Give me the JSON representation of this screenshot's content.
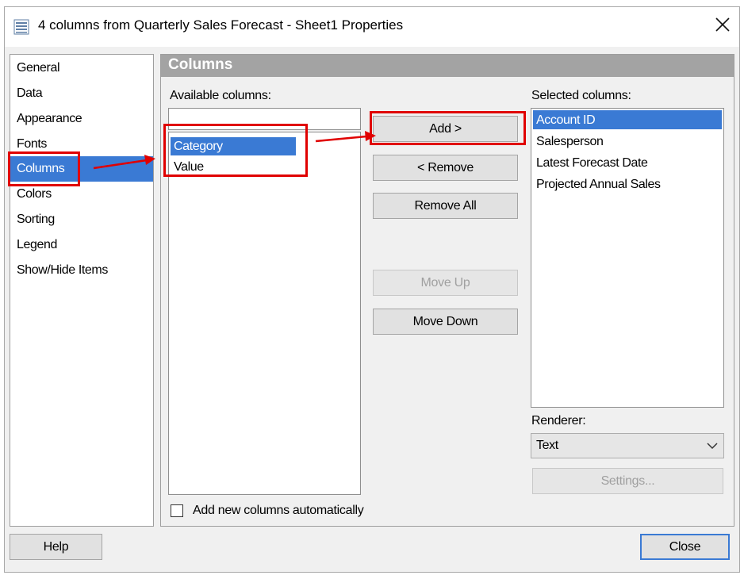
{
  "window": {
    "title": "4 columns from Quarterly Sales Forecast - Sheet1 Properties",
    "icon": "list-icon",
    "close_icon": "close-icon"
  },
  "nav": {
    "items": [
      {
        "label": "General"
      },
      {
        "label": "Data"
      },
      {
        "label": "Appearance"
      },
      {
        "label": "Fonts"
      },
      {
        "label": "Columns",
        "selected": true
      },
      {
        "label": "Colors"
      },
      {
        "label": "Sorting"
      },
      {
        "label": "Legend"
      },
      {
        "label": "Show/Hide Items"
      }
    ]
  },
  "panel": {
    "title": "Columns",
    "available_label": "Available columns:",
    "search_value": "",
    "available": [
      {
        "label": "Category",
        "selected": true
      },
      {
        "label": "Value"
      }
    ],
    "buttons": {
      "add": "Add >",
      "remove": "< Remove",
      "remove_all": "Remove All",
      "move_up": "Move Up",
      "move_down": "Move Down"
    },
    "selected_label": "Selected columns:",
    "selected": [
      {
        "label": "Account ID",
        "selected": true
      },
      {
        "label": "Salesperson"
      },
      {
        "label": "Latest Forecast Date"
      },
      {
        "label": "Projected Annual Sales"
      }
    ],
    "renderer_label": "Renderer:",
    "renderer_value": "Text",
    "settings_button": "Settings...",
    "auto_add_label": "Add new columns automatically",
    "auto_add_checked": false
  },
  "footer": {
    "help": "Help",
    "close": "Close"
  },
  "colors": {
    "selection": "#3a7ad4",
    "annotation": "#e00000",
    "header": "#a3a3a3"
  }
}
